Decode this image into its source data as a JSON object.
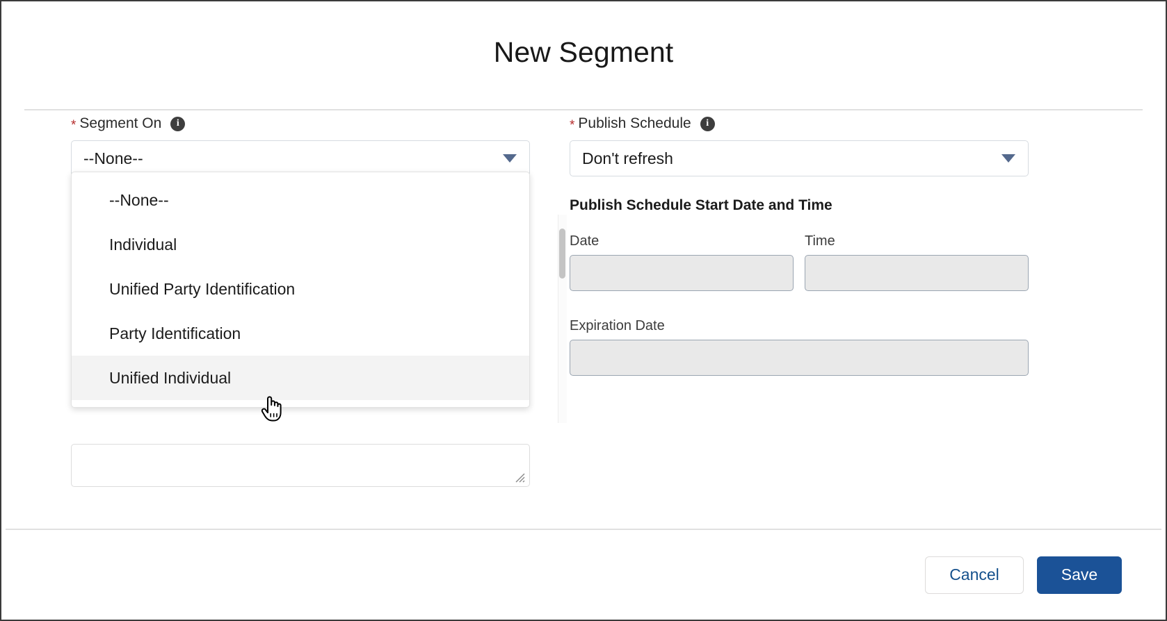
{
  "dialog": {
    "title": "New Segment"
  },
  "segment_on": {
    "label": "Segment On",
    "required_marker": "*",
    "info_icon": "info-icon",
    "selected_value": "--None--",
    "chevron_icon": "chevron-down-icon",
    "options": [
      {
        "label": "--None--",
        "state": "normal"
      },
      {
        "label": "Individual",
        "state": "normal"
      },
      {
        "label": "Unified Party Identification",
        "state": "normal"
      },
      {
        "label": "Party Identification",
        "state": "normal"
      },
      {
        "label": "Unified Individual",
        "state": "highlight"
      }
    ]
  },
  "publish_schedule": {
    "label": "Publish Schedule",
    "required_marker": "*",
    "info_icon": "info-icon",
    "selected_value": "Don't refresh",
    "chevron_icon": "chevron-down-icon",
    "start_heading": "Publish Schedule Start Date and Time",
    "date_label": "Date",
    "date_value": "",
    "time_label": "Time",
    "time_value": "",
    "expiration_label": "Expiration Date",
    "expiration_value": ""
  },
  "footer": {
    "cancel_label": "Cancel",
    "save_label": "Save"
  },
  "colors": {
    "brand_blue": "#1b5297",
    "link_blue": "#14508c",
    "required_red": "#b52c2c",
    "chevron_blue_gray": "#54698d",
    "disabled_fill": "#e9e9e9",
    "disabled_border": "#9aa5b1",
    "highlight_row": "#f3f3f3"
  }
}
